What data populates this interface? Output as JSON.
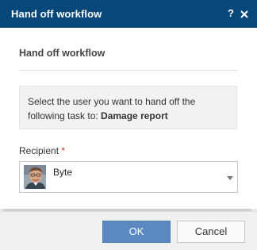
{
  "dialog": {
    "title": "Hand off workflow",
    "help_label": "?",
    "close_icon": "close-icon"
  },
  "form": {
    "section_title": "Hand off workflow",
    "info_text_line1": "Select the user you want to hand off the",
    "info_text_prefix": "following task to: ",
    "task_name": "Damage report",
    "recipient_label": "Recipient",
    "required_marker": "*",
    "recipient_value": "Byte"
  },
  "footer": {
    "ok_label": "OK",
    "cancel_label": "Cancel"
  },
  "colors": {
    "titlebar": "#07477a",
    "primary_button": "#5b88c0",
    "required": "#c0392b"
  }
}
